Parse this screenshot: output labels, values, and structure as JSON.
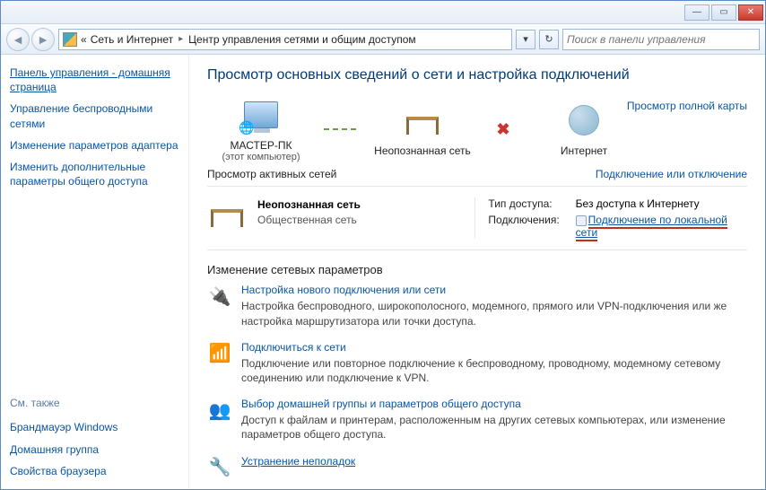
{
  "titlebar": {
    "min": "—",
    "max": "▭",
    "close": "✕"
  },
  "toolbar": {
    "back": "◄",
    "forward": "►",
    "crumb_pre": "«",
    "crumb1": "Сеть и Интернет",
    "crumb2": "Центр управления сетями и общим доступом",
    "dropdown": "▾",
    "refresh": "↻",
    "search_placeholder": "Поиск в панели управления"
  },
  "sidebar": {
    "home": "Панель управления - домашняя страница",
    "links": [
      "Управление беспроводными сетями",
      "Изменение параметров адаптера",
      "Изменить дополнительные параметры общего доступа"
    ],
    "see_also_heading": "См. также",
    "see_also": [
      "Брандмауэр Windows",
      "Домашняя группа",
      "Свойства браузера"
    ]
  },
  "content": {
    "heading": "Просмотр основных сведений о сети и настройка подключений",
    "map_link": "Просмотр полной карты",
    "nodes": {
      "pc": "МАСТЕР-ПК",
      "pc_sub": "(этот компьютер)",
      "unknown": "Неопознанная сеть",
      "internet": "Интернет"
    },
    "active_heading": "Просмотр активных сетей",
    "active_toggle": "Подключение или отключение",
    "active": {
      "name": "Неопознанная сеть",
      "type": "Общественная сеть",
      "access_key": "Тип доступа:",
      "access_val": "Без доступа к Интернету",
      "conn_key": "Подключения:",
      "conn_val": "Подключение по локальной сети"
    },
    "settings_heading": "Изменение сетевых параметров",
    "settings": [
      {
        "title": "Настройка нового подключения или сети",
        "desc": "Настройка беспроводного, широкополосного, модемного, прямого или VPN-подключения или же настройка маршрутизатора или точки доступа."
      },
      {
        "title": "Подключиться к сети",
        "desc": "Подключение или повторное подключение к беспроводному, проводному, модемному сетевому соединению или подключение к VPN."
      },
      {
        "title": "Выбор домашней группы и параметров общего доступа",
        "desc": "Доступ к файлам и принтерам, расположенным на других сетевых компьютерах, или изменение параметров общего доступа."
      },
      {
        "title": "Устранение неполадок",
        "desc": ""
      }
    ]
  }
}
